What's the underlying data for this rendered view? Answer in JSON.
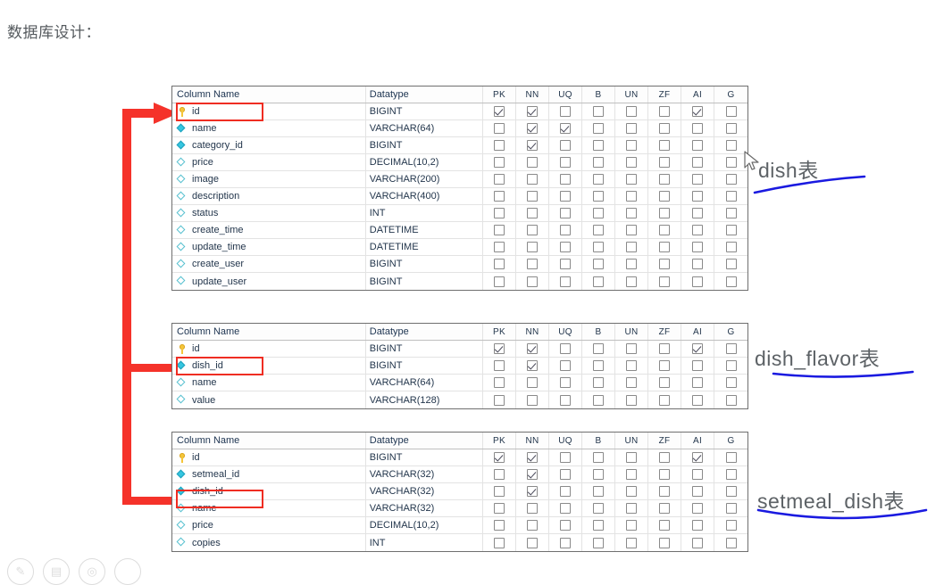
{
  "slide": {
    "title": "数据库设计："
  },
  "table_columns": {
    "name_header": "Column Name",
    "type_header": "Datatype",
    "flags": [
      "PK",
      "NN",
      "UQ",
      "B",
      "UN",
      "ZF",
      "AI",
      "G"
    ]
  },
  "tables": [
    {
      "id": "dish",
      "annotation": "dish表",
      "rows": [
        {
          "icon": "key",
          "name": "id",
          "type": "BIGINT",
          "flags": [
            1,
            1,
            0,
            0,
            0,
            0,
            1,
            0
          ],
          "highlight": true
        },
        {
          "icon": "dia-f",
          "name": "name",
          "type": "VARCHAR(64)",
          "flags": [
            0,
            1,
            1,
            0,
            0,
            0,
            0,
            0
          ],
          "highlight": false
        },
        {
          "icon": "dia-f",
          "name": "category_id",
          "type": "BIGINT",
          "flags": [
            0,
            1,
            0,
            0,
            0,
            0,
            0,
            0
          ],
          "highlight": false
        },
        {
          "icon": "dia-o",
          "name": "price",
          "type": "DECIMAL(10,2)",
          "flags": [
            0,
            0,
            0,
            0,
            0,
            0,
            0,
            0
          ],
          "highlight": false
        },
        {
          "icon": "dia-o",
          "name": "image",
          "type": "VARCHAR(200)",
          "flags": [
            0,
            0,
            0,
            0,
            0,
            0,
            0,
            0
          ],
          "highlight": false
        },
        {
          "icon": "dia-o",
          "name": "description",
          "type": "VARCHAR(400)",
          "flags": [
            0,
            0,
            0,
            0,
            0,
            0,
            0,
            0
          ],
          "highlight": false
        },
        {
          "icon": "dia-o",
          "name": "status",
          "type": "INT",
          "flags": [
            0,
            0,
            0,
            0,
            0,
            0,
            0,
            0
          ],
          "highlight": false
        },
        {
          "icon": "dia-o",
          "name": "create_time",
          "type": "DATETIME",
          "flags": [
            0,
            0,
            0,
            0,
            0,
            0,
            0,
            0
          ],
          "highlight": false
        },
        {
          "icon": "dia-o",
          "name": "update_time",
          "type": "DATETIME",
          "flags": [
            0,
            0,
            0,
            0,
            0,
            0,
            0,
            0
          ],
          "highlight": false
        },
        {
          "icon": "dia-o",
          "name": "create_user",
          "type": "BIGINT",
          "flags": [
            0,
            0,
            0,
            0,
            0,
            0,
            0,
            0
          ],
          "highlight": false
        },
        {
          "icon": "dia-o",
          "name": "update_user",
          "type": "BIGINT",
          "flags": [
            0,
            0,
            0,
            0,
            0,
            0,
            0,
            0
          ],
          "highlight": false
        }
      ]
    },
    {
      "id": "dish_flavor",
      "annotation": "dish_flavor表",
      "rows": [
        {
          "icon": "key",
          "name": "id",
          "type": "BIGINT",
          "flags": [
            1,
            1,
            0,
            0,
            0,
            0,
            1,
            0
          ],
          "highlight": false
        },
        {
          "icon": "dia-f",
          "name": "dish_id",
          "type": "BIGINT",
          "flags": [
            0,
            1,
            0,
            0,
            0,
            0,
            0,
            0
          ],
          "highlight": true
        },
        {
          "icon": "dia-o",
          "name": "name",
          "type": "VARCHAR(64)",
          "flags": [
            0,
            0,
            0,
            0,
            0,
            0,
            0,
            0
          ],
          "highlight": false
        },
        {
          "icon": "dia-o",
          "name": "value",
          "type": "VARCHAR(128)",
          "flags": [
            0,
            0,
            0,
            0,
            0,
            0,
            0,
            0
          ],
          "highlight": false
        }
      ]
    },
    {
      "id": "setmeal_dish",
      "annotation": "setmeal_dish表",
      "rows": [
        {
          "icon": "key",
          "name": "id",
          "type": "BIGINT",
          "flags": [
            1,
            1,
            0,
            0,
            0,
            0,
            1,
            0
          ],
          "highlight": false
        },
        {
          "icon": "dia-f",
          "name": "setmeal_id",
          "type": "VARCHAR(32)",
          "flags": [
            0,
            1,
            0,
            0,
            0,
            0,
            0,
            0
          ],
          "highlight": false
        },
        {
          "icon": "dia-f",
          "name": "dish_id",
          "type": "VARCHAR(32)",
          "flags": [
            0,
            1,
            0,
            0,
            0,
            0,
            0,
            0
          ],
          "highlight": true
        },
        {
          "icon": "dia-o",
          "name": "name",
          "type": "VARCHAR(32)",
          "flags": [
            0,
            0,
            0,
            0,
            0,
            0,
            0,
            0
          ],
          "highlight": false
        },
        {
          "icon": "dia-o",
          "name": "price",
          "type": "DECIMAL(10,2)",
          "flags": [
            0,
            0,
            0,
            0,
            0,
            0,
            0,
            0
          ],
          "highlight": false
        },
        {
          "icon": "dia-o",
          "name": "copies",
          "type": "INT",
          "flags": [
            0,
            0,
            0,
            0,
            0,
            0,
            0,
            0
          ],
          "highlight": false
        }
      ]
    }
  ],
  "colors": {
    "highlight_red": "#ef2d22",
    "connector_red": "#f5322a",
    "underline_blue": "#1a1ae0",
    "key_yellow": "#f5c63a",
    "diamond_cyan": "#35c6e0"
  },
  "bottom_icons": [
    "pen-icon",
    "board-icon",
    "mouse-icon",
    "circle-icon"
  ]
}
